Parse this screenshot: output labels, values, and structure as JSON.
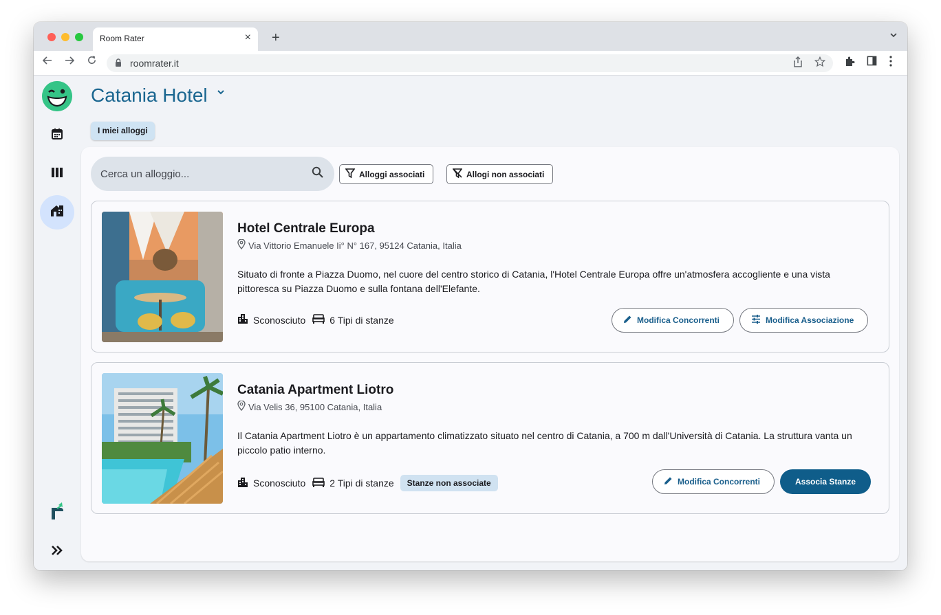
{
  "browser": {
    "tab_title": "Room Rater",
    "close_glyph": "×",
    "newtab_glyph": "+",
    "url": "roomrater.it"
  },
  "app": {
    "hotel_name": "Catania Hotel",
    "chip_label": "I miei alloggi",
    "search_placeholder": "Cerca un alloggio...",
    "filters": [
      "Alloggi associati",
      "Allogi non associati"
    ],
    "listings": [
      {
        "title": "Hotel Centrale Europa",
        "address": "Via Vittorio Emanuele Ii° N° 167, 95124 Catania, Italia",
        "description": "Situato di fronte a Piazza Duomo, nel cuore del centro storico di Catania, l'Hotel Centrale Europa offre un'atmosfera accogliente e una vista pittoresca su Piazza Duomo e sulla fontana dell'Elefante.",
        "category": "Sconosciuto",
        "room_types": "6 Tipi di stanze",
        "button_edit": "Modifica Concorrenti",
        "button_assoc": "Modifica Associazione"
      },
      {
        "title": "Catania Apartment Liotro",
        "address": "Via Velis 36, 95100 Catania, Italia",
        "description": "Il Catania Apartment Liotro è un appartamento climatizzato situato nel centro di Catania, a 700 m dall'Università di Catania. La struttura vanta un piccolo patio interno.",
        "category": "Sconosciuto",
        "room_types": "2 Tipi di stanze",
        "badge": "Stanze non associate",
        "button_edit": "Modifica Concorrenti",
        "button_assoc": "Associa Stanze"
      }
    ]
  },
  "colors": {
    "accent": "#1a6690",
    "primary_button": "#0f5d8a",
    "rail_active": "#d3e3fd",
    "logo": "#35c487"
  },
  "icons": [
    "lock-icon",
    "share-icon",
    "star-icon",
    "extensions-icon",
    "sidepanel-icon",
    "more-icon",
    "calendar-icon",
    "columns-icon",
    "home-icon",
    "hand-icon",
    "expand-icon",
    "search-icon",
    "filter-icon",
    "filter-off-icon",
    "pin-icon",
    "building-icon",
    "bed-icon",
    "edit-icon",
    "tune-icon"
  ]
}
